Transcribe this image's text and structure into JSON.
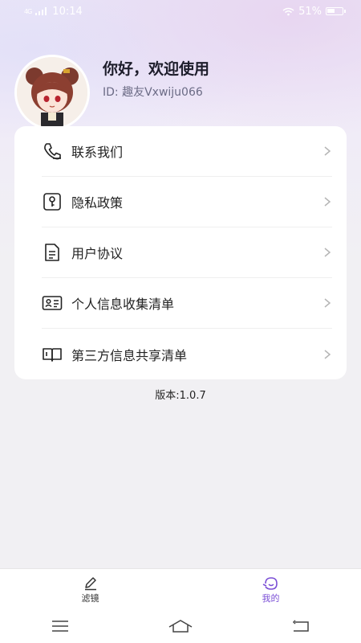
{
  "status_bar": {
    "signal": "4G",
    "time": "10:14",
    "battery": "51%"
  },
  "profile": {
    "greeting": "你好，欢迎使用",
    "user_id": "ID: 趣友Vxwiju066"
  },
  "menu": {
    "items": [
      {
        "label": "联系我们",
        "icon": "phone-icon"
      },
      {
        "label": "隐私政策",
        "icon": "key-lock-icon"
      },
      {
        "label": "用户协议",
        "icon": "document-icon"
      },
      {
        "label": "个人信息收集清单",
        "icon": "id-card-icon"
      },
      {
        "label": "第三方信息共享清单",
        "icon": "open-book-icon"
      }
    ]
  },
  "version": "版本:1.0.7",
  "tabs": [
    {
      "label": "滤镜",
      "icon": "pen-icon",
      "active": false
    },
    {
      "label": "我的",
      "icon": "smile-face-icon",
      "active": true
    }
  ],
  "colors": {
    "accent": "#7b4fd6",
    "background": "#f1f0f3",
    "card": "#ffffff"
  }
}
